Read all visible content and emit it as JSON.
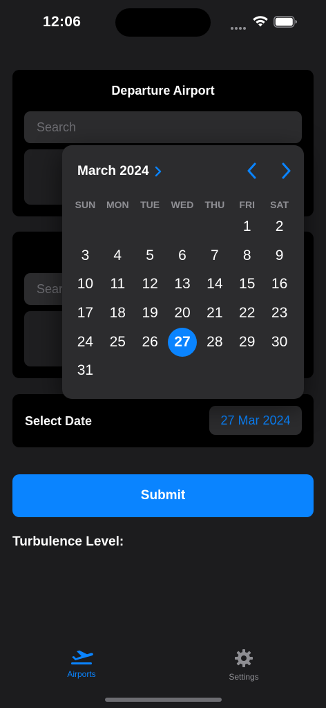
{
  "status": {
    "time": "12:06"
  },
  "departure": {
    "title": "Departure Airport",
    "search_placeholder": "Search"
  },
  "arrival": {
    "search_placeholder": "Search"
  },
  "date": {
    "label": "Select Date",
    "value": "27 Mar 2024"
  },
  "calendar": {
    "month_label": "March 2024",
    "weekdays": [
      "SUN",
      "MON",
      "TUE",
      "WED",
      "THU",
      "FRI",
      "SAT"
    ],
    "first_weekday_index": 5,
    "days_in_month": 31,
    "selected_day": 27
  },
  "submit_label": "Submit",
  "turbulence_label": "Turbulence Level:",
  "tabs": [
    {
      "label": "Airports",
      "icon": "airplane-departure-icon",
      "active": true
    },
    {
      "label": "Settings",
      "icon": "gear-icon",
      "active": false
    }
  ],
  "colors": {
    "accent": "#0a84ff",
    "background": "#1c1c1e",
    "card": "#000000",
    "popup": "#2c2c2e"
  }
}
